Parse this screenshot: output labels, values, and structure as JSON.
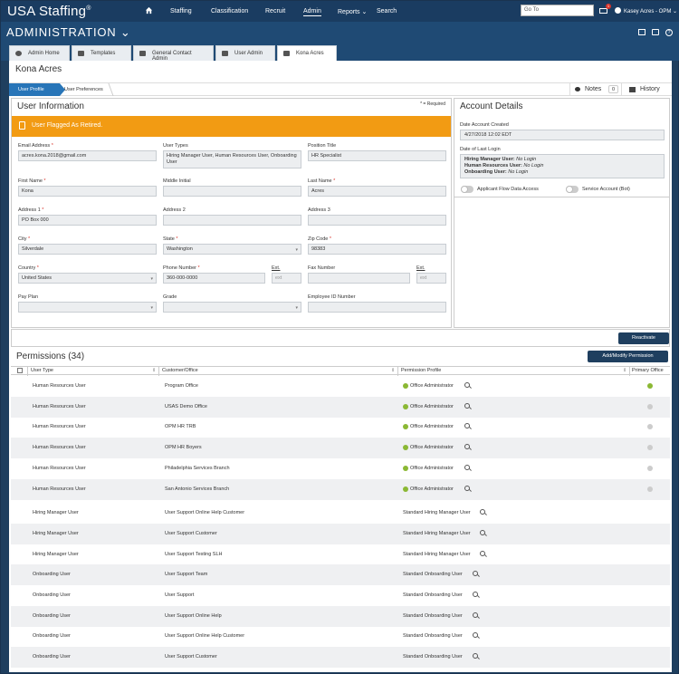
{
  "topbar": {
    "logo": "USA Staffing",
    "logo_mark": "®",
    "nav": [
      "Staffing",
      "Classification",
      "Recruit",
      "Admin",
      "Reports ⌄",
      "Search"
    ],
    "goto_placeholder": "Go To",
    "mail_badge": "1",
    "user_name": "Kasey Acres - OPM ⌄"
  },
  "adminbar": {
    "title": "ADMINISTRATION ⌄"
  },
  "tabs": [
    {
      "label": "Admin Home",
      "icon": "gear-icon"
    },
    {
      "label": "Templates",
      "icon": "puzzle-icon"
    },
    {
      "label": "General Contact Admin",
      "icon": "contact-icon"
    },
    {
      "label": "User Admin",
      "icon": "users-icon"
    },
    {
      "label": "Kona Acres",
      "icon": "users-icon"
    }
  ],
  "page_title": "Kona Acres",
  "subnav": {
    "crumbs": [
      "User Profile",
      "User Preferences"
    ],
    "notes_label": "Notes",
    "notes_count": "0",
    "history_label": "History"
  },
  "user_info": {
    "title": "User Information",
    "required_note": "* = Required",
    "banner": "User Flagged As Retired.",
    "fields": {
      "email": {
        "label": "Email Address",
        "value": "acres.kona.2018@gmail.com"
      },
      "user_types": {
        "label": "User Types",
        "value": "Hiring Manager User, Human Resources User, Onboarding User"
      },
      "position_title": {
        "label": "Position Title",
        "value": "HR Specialist"
      },
      "first_name": {
        "label": "First Name",
        "value": "Kona"
      },
      "middle_initial": {
        "label": "Middle Initial",
        "value": ""
      },
      "last_name": {
        "label": "Last Name",
        "value": "Acres"
      },
      "address1": {
        "label": "Address 1",
        "value": "PO Box 000"
      },
      "address2": {
        "label": "Address 2",
        "value": ""
      },
      "address3": {
        "label": "Address 3",
        "value": ""
      },
      "city": {
        "label": "City",
        "value": "Silverdale"
      },
      "state": {
        "label": "State",
        "value": "Washington"
      },
      "zip": {
        "label": "Zip Code",
        "value": "98383"
      },
      "country": {
        "label": "Country",
        "value": "United States"
      },
      "phone": {
        "label": "Phone Number",
        "value": "360-000-0000"
      },
      "ext1": {
        "label": "Ext.",
        "placeholder": "ext"
      },
      "fax": {
        "label": "Fax Number",
        "value": ""
      },
      "ext2": {
        "label": "Ext.",
        "placeholder": "ext"
      },
      "pay_plan": {
        "label": "Pay Plan",
        "value": ""
      },
      "grade": {
        "label": "Grade",
        "value": ""
      },
      "employee_id": {
        "label": "Employee ID Number",
        "value": ""
      }
    }
  },
  "account_details": {
    "title": "Account Details",
    "created_label": "Date Account Created",
    "created_value": "4/27/2018 12:02 EDT",
    "last_login_label": "Date of Last Login",
    "last_login": [
      {
        "type": "Hiring Manager User:",
        "value": "No Login"
      },
      {
        "type": "Human Resources User:",
        "value": "No Login"
      },
      {
        "type": "Onboarding User:",
        "value": "No Login"
      }
    ],
    "toggle1": "Applicant Flow Data Access",
    "toggle2": "Service Account (Bot)"
  },
  "reactivate_label": "Reactivate",
  "permissions": {
    "title": "Permissions (34)",
    "add_button": "Add/Modify Permission",
    "columns": [
      "User Type",
      "Customer/Office",
      "Permission Profile",
      "Primary Office"
    ],
    "rows": [
      {
        "user_type": "Human Resources User",
        "office": "Program Office",
        "profile": "Office Administrator",
        "primary": true
      },
      {
        "user_type": "Human Resources User",
        "office": "USAS Demo Office",
        "profile": "Office Administrator",
        "primary": false
      },
      {
        "user_type": "Human Resources User",
        "office": "OPM HR TRB",
        "profile": "Office Administrator",
        "primary": false
      },
      {
        "user_type": "Human Resources User",
        "office": "OPM HR Boyers",
        "profile": "Office Administrator",
        "primary": false
      },
      {
        "user_type": "Human Resources User",
        "office": "Philadelphia Services Branch",
        "profile": "Office Administrator",
        "primary": false
      },
      {
        "user_type": "Human Resources User",
        "office": "San Antonio Services Branch",
        "profile": "Office Administrator",
        "primary": false
      },
      {
        "user_type": "Hiring Manager User",
        "office": "User Support Online Help Customer",
        "profile": "Standard Hiring Manager User",
        "primary": null
      },
      {
        "user_type": "Hiring Manager User",
        "office": "User Support Customer",
        "profile": "Standard Hiring Manager User",
        "primary": null
      },
      {
        "user_type": "Hiring Manager User",
        "office": "User Support Testing SLH",
        "profile": "Standard Hiring Manager User",
        "primary": null
      },
      {
        "user_type": "Onboarding User",
        "office": "User Support Team",
        "profile": "Standard Onboarding User",
        "primary": null
      },
      {
        "user_type": "Onboarding User",
        "office": "User Support",
        "profile": "Standard Onboarding User",
        "primary": null
      },
      {
        "user_type": "Onboarding User",
        "office": "User Support Online Help",
        "profile": "Standard Onboarding User",
        "primary": null
      },
      {
        "user_type": "Onboarding User",
        "office": "User Support Online Help Customer",
        "profile": "Standard Onboarding User",
        "primary": null
      },
      {
        "user_type": "Onboarding User",
        "office": "User Support Customer",
        "profile": "Standard Onboarding User",
        "primary": null
      }
    ]
  },
  "colors": {
    "navy": "#1a3c61",
    "accent_blue": "#2875b8",
    "banner_orange": "#f29b13",
    "check_green": "#8bb834"
  }
}
